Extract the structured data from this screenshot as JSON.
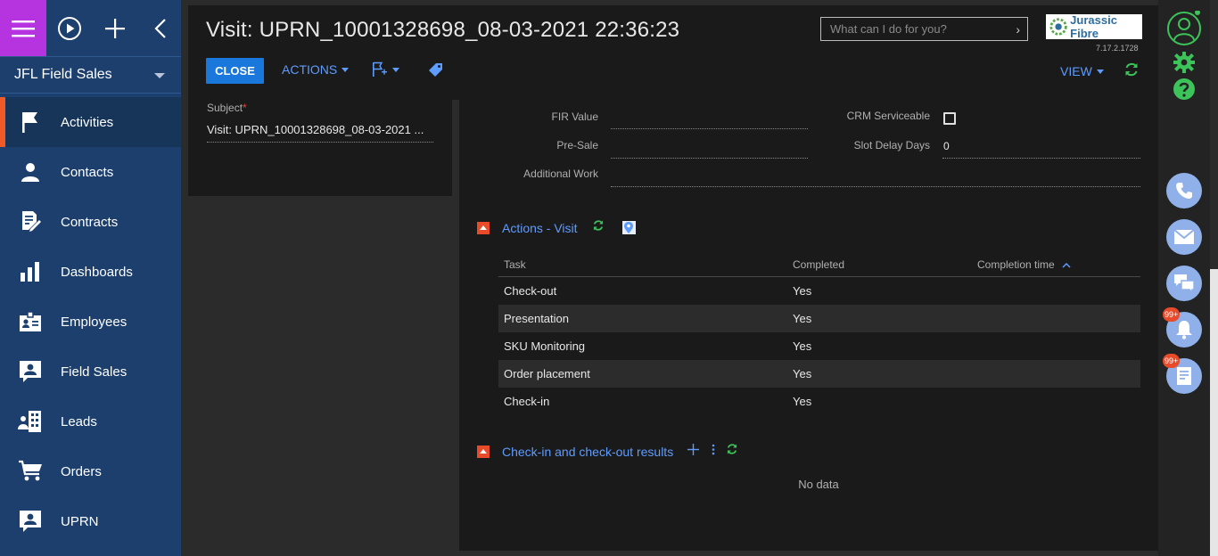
{
  "sidebar": {
    "workspace": "JFL Field Sales",
    "items": [
      {
        "label": "Activities",
        "icon": "flag-icon"
      },
      {
        "label": "Contacts",
        "icon": "person-icon"
      },
      {
        "label": "Contracts",
        "icon": "contract-icon"
      },
      {
        "label": "Dashboards",
        "icon": "bar-chart-icon"
      },
      {
        "label": "Employees",
        "icon": "badge-icon"
      },
      {
        "label": "Field Sales",
        "icon": "contact-card-icon"
      },
      {
        "label": "Leads",
        "icon": "building-icon"
      },
      {
        "label": "Orders",
        "icon": "cart-icon"
      },
      {
        "label": "UPRN",
        "icon": "contact-card-icon"
      }
    ]
  },
  "header": {
    "title": "Visit: UPRN_10001328698_08-03-2021 22:36:23",
    "close_label": "CLOSE",
    "actions_label": "ACTIONS",
    "view_label": "VIEW",
    "search_placeholder": "What can I do for you?",
    "logo_text": "Jurassic Fibre",
    "version": "7.17.2.1728"
  },
  "left_panel": {
    "subject_label": "Subject",
    "subject_value": "Visit: UPRN_10001328698_08-03-2021 ..."
  },
  "fields": {
    "fir_value_label": "FIR Value",
    "fir_value": "",
    "pre_sale_label": "Pre-Sale",
    "pre_sale": "",
    "additional_work_label": "Additional Work",
    "additional_work": "",
    "crm_serviceable_label": "CRM Serviceable",
    "crm_serviceable": false,
    "slot_delay_days_label": "Slot Delay Days",
    "slot_delay_days": "0"
  },
  "actions_visit": {
    "title": "Actions - Visit",
    "columns": {
      "task": "Task",
      "completed": "Completed",
      "completion_time": "Completion time"
    },
    "rows": [
      {
        "task": "Check-out",
        "completed": "Yes",
        "completion_time": ""
      },
      {
        "task": "Presentation",
        "completed": "Yes",
        "completion_time": ""
      },
      {
        "task": "SKU Monitoring",
        "completed": "Yes",
        "completion_time": ""
      },
      {
        "task": "Order placement",
        "completed": "Yes",
        "completion_time": ""
      },
      {
        "task": "Check-in",
        "completed": "Yes",
        "completion_time": ""
      }
    ]
  },
  "checkin_results": {
    "title": "Check-in and check-out results",
    "empty_text": "No data"
  },
  "right_bar": {
    "notifications_badge": "99+",
    "feed_badge": "99+"
  },
  "colors": {
    "sidebar_bg": "#1c3f6e",
    "menu_accent": "#b634e0",
    "active_marker": "#f05a28",
    "link_blue": "#5e9cff",
    "primary_button": "#1a78dc",
    "refresh_green": "#3cc45a",
    "badge_red": "#e84a2a"
  }
}
